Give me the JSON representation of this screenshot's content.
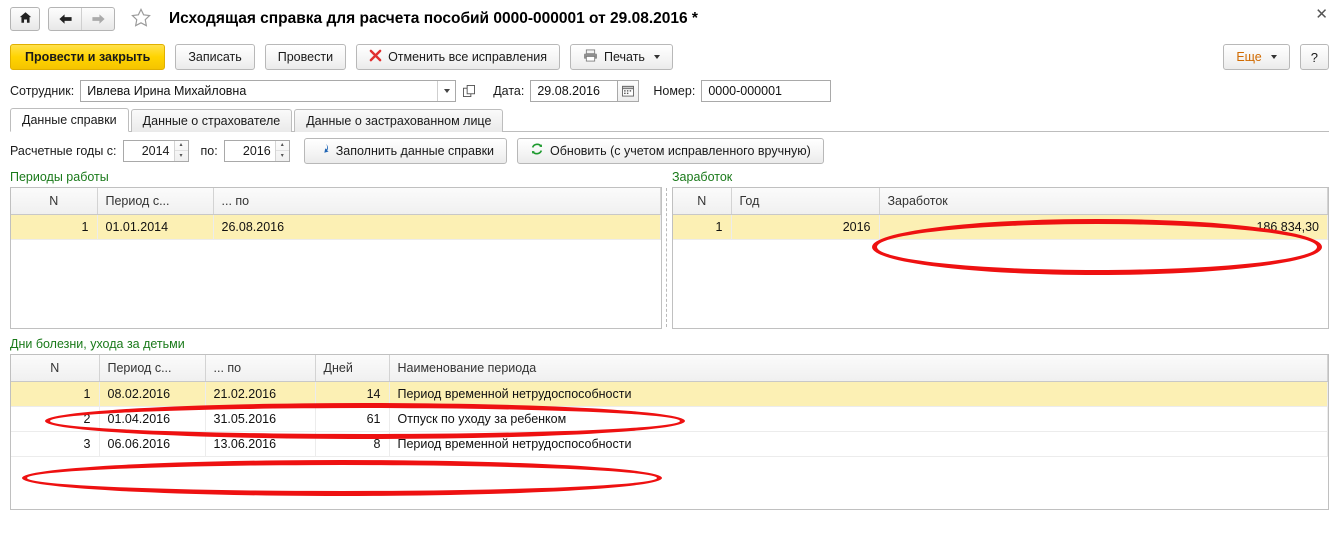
{
  "titlebar": {
    "home_icon": "home-icon",
    "back_icon": "arrow-left-icon",
    "forward_icon": "arrow-right-icon",
    "favorite_icon": "star-outline-icon",
    "title": "Исходящая справка для расчета пособий 0000-000001 от 29.08.2016 *",
    "close_label": "✕"
  },
  "toolbar": {
    "post_and_close": "Провести и закрыть",
    "write": "Записать",
    "post": "Провести",
    "cancel_corrections": "Отменить все исправления",
    "cancel_icon": "red-x-icon",
    "print": "Печать",
    "print_icon": "printer-icon",
    "more": "Еще",
    "help": "?"
  },
  "form": {
    "employee_label": "Сотрудник:",
    "employee_value": "Ивлева Ирина Михайловна",
    "employee_dropdown_icon": "chevron-down-icon",
    "employee_pick_icon": "open-form-icon",
    "date_label": "Дата:",
    "date_value": "29.08.2016",
    "calendar_icon": "calendar-icon",
    "number_label": "Номер:",
    "number_value": "0000-000001"
  },
  "tabs": [
    {
      "label": "Данные справки",
      "active": true
    },
    {
      "label": "Данные о страхователе",
      "active": false
    },
    {
      "label": "Данные о застрахованном лице",
      "active": false
    }
  ],
  "years": {
    "label_from": "Расчетные годы с:",
    "value_from": "2014",
    "label_to": "по:",
    "value_to": "2016",
    "fill_button": "Заполнить данные справки",
    "fill_icon": "blue-down-arrow-icon",
    "refresh_button": "Обновить (с учетом исправленного вручную)",
    "refresh_icon": "green-refresh-icon",
    "spin_up": "▴",
    "spin_down": "▾"
  },
  "work_periods": {
    "title": "Периоды работы",
    "columns": [
      "N",
      "Период с...",
      "... по"
    ],
    "rows": [
      {
        "n": "1",
        "from": "01.01.2014",
        "to": "26.08.2016",
        "selected": true
      }
    ]
  },
  "earnings": {
    "title": "Заработок",
    "columns": [
      "N",
      "Год",
      "Заработок"
    ],
    "rows": [
      {
        "n": "1",
        "year": "2016",
        "amount": "186 834,30",
        "selected": true
      }
    ]
  },
  "sick_days": {
    "title": "Дни болезни, ухода за детьми",
    "columns": [
      "N",
      "Период с...",
      "... по",
      "Дней",
      "Наименование периода"
    ],
    "rows": [
      {
        "n": "1",
        "from": "08.02.2016",
        "to": "21.02.2016",
        "days": "14",
        "name": "Период временной нетрудоспособности",
        "selected": true
      },
      {
        "n": "2",
        "from": "01.04.2016",
        "to": "31.05.2016",
        "days": "61",
        "name": "Отпуск по уходу за ребенком",
        "selected": false
      },
      {
        "n": "3",
        "from": "06.06.2016",
        "to": "13.06.2016",
        "days": "8",
        "name": "Период временной нетрудоспособности",
        "selected": false
      }
    ]
  },
  "annotations": {
    "color": "#ee1111",
    "ovals": [
      {
        "name": "earnings-amount-highlight"
      },
      {
        "name": "sick-row-1-highlight"
      },
      {
        "name": "sick-row-3-highlight"
      }
    ]
  }
}
